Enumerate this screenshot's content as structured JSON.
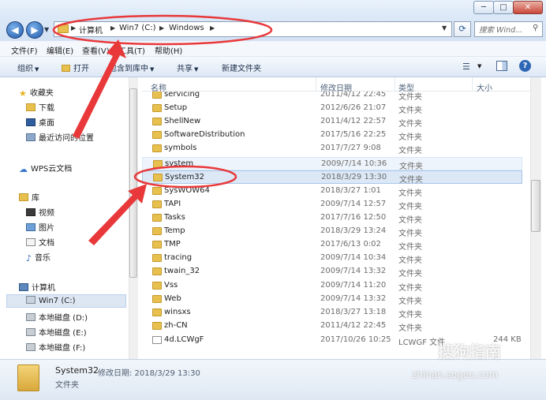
{
  "window": {
    "minimize": "─",
    "maximize": "□",
    "close": "✕"
  },
  "address": {
    "crumbs": [
      "计算机",
      "Win7 (C:)",
      "Windows"
    ],
    "search_placeholder": "搜索 Wind..."
  },
  "menu": [
    "文件(F)",
    "编辑(E)",
    "查看(V)",
    "工具(T)",
    "帮助(H)"
  ],
  "toolbar": {
    "organize": "组织",
    "open": "打开",
    "include": "包含到库中",
    "share": "共享",
    "new_folder": "新建文件夹"
  },
  "nav": {
    "favorites": "收藏夹",
    "downloads": "下载",
    "desktop": "桌面",
    "recent": "最近访问的位置",
    "wps": "WPS云文档",
    "libraries": "库",
    "videos": "视频",
    "pictures": "图片",
    "documents": "文档",
    "music": "音乐",
    "computer": "计算机",
    "win7": "Win7 (C:)",
    "disk_d": "本地磁盘 (D:)",
    "disk_e": "本地磁盘 (E:)",
    "disk_f": "本地磁盘 (F:)"
  },
  "columns": {
    "name": "名称",
    "date": "修改日期",
    "type": "类型",
    "size": "大小"
  },
  "files": [
    {
      "name": "servicing",
      "date": "2011/4/12 22:45",
      "type": "文件夹",
      "size": ""
    },
    {
      "name": "Setup",
      "date": "2012/6/26 21:07",
      "type": "文件夹",
      "size": ""
    },
    {
      "name": "ShellNew",
      "date": "2011/4/12 22:57",
      "type": "文件夹",
      "size": ""
    },
    {
      "name": "SoftwareDistribution",
      "date": "2017/5/16 22:25",
      "type": "文件夹",
      "size": ""
    },
    {
      "name": "symbols",
      "date": "2017/7/27 9:08",
      "type": "文件夹",
      "size": ""
    },
    {
      "name": "system",
      "date": "2009/7/14 10:36",
      "type": "文件夹",
      "size": ""
    },
    {
      "name": "System32",
      "date": "2018/3/29 13:30",
      "type": "文件夹",
      "size": ""
    },
    {
      "name": "SysWOW64",
      "date": "2018/3/27 1:01",
      "type": "文件夹",
      "size": ""
    },
    {
      "name": "TAPI",
      "date": "2009/7/14 12:57",
      "type": "文件夹",
      "size": ""
    },
    {
      "name": "Tasks",
      "date": "2017/7/16 12:50",
      "type": "文件夹",
      "size": ""
    },
    {
      "name": "Temp",
      "date": "2018/3/29 13:24",
      "type": "文件夹",
      "size": ""
    },
    {
      "name": "TMP",
      "date": "2017/6/13 0:02",
      "type": "文件夹",
      "size": ""
    },
    {
      "name": "tracing",
      "date": "2009/7/14 10:34",
      "type": "文件夹",
      "size": ""
    },
    {
      "name": "twain_32",
      "date": "2009/7/14 13:32",
      "type": "文件夹",
      "size": ""
    },
    {
      "name": "Vss",
      "date": "2009/7/14 11:20",
      "type": "文件夹",
      "size": ""
    },
    {
      "name": "Web",
      "date": "2009/7/14 13:32",
      "type": "文件夹",
      "size": ""
    },
    {
      "name": "winsxs",
      "date": "2018/3/27 13:18",
      "type": "文件夹",
      "size": ""
    },
    {
      "name": "zh-CN",
      "date": "2011/4/12 22:45",
      "type": "文件夹",
      "size": ""
    },
    {
      "name": "4d.LCWgF",
      "date": "2017/10/26 10:25",
      "type": "LCWGF 文件",
      "size": "244 KB"
    }
  ],
  "details": {
    "name": "System32",
    "modified_label": "修改日期: 2018/3/29 13:30",
    "type": "文件夹"
  },
  "watermark": {
    "text": "搜狗指南",
    "url": "zhinan.sogou.com"
  },
  "colors": {
    "annotation": "#e8383a",
    "selection": "#dce8f6",
    "folder": "#e8c04e"
  }
}
